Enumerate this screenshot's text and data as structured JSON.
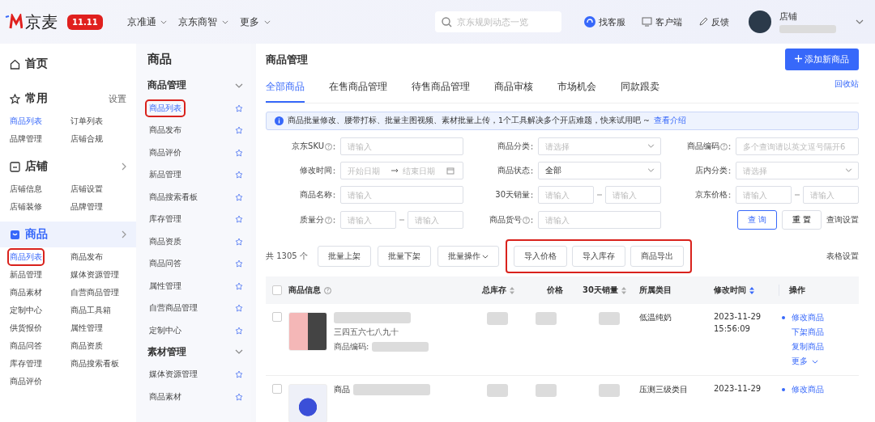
{
  "topbar": {
    "logo": "京麦",
    "badge": "11.11",
    "nav": [
      {
        "label": "京准通"
      },
      {
        "label": "京东商智"
      },
      {
        "label": "更多"
      }
    ],
    "search": {
      "placeholder": "京东规则动态一览"
    },
    "actions": [
      {
        "kind": "service",
        "label": "找客服"
      },
      {
        "kind": "client",
        "label": "客户端"
      },
      {
        "kind": "feedback",
        "label": "反馈"
      }
    ],
    "store": "店铺"
  },
  "sidebar": {
    "home": "首页",
    "sections": [
      {
        "kind": "favorites",
        "title": "常用",
        "link": "设置",
        "selected": false,
        "items": [
          {
            "label": "商品列表",
            "selected": true,
            "highlighted": false
          },
          {
            "label": "订单列表",
            "selected": false,
            "highlighted": false
          },
          {
            "label": "品牌管理",
            "selected": false,
            "highlighted": false
          },
          {
            "label": "店铺合规",
            "selected": false,
            "highlighted": false
          }
        ]
      },
      {
        "kind": "store",
        "title": "店铺",
        "selected": false,
        "items": [
          {
            "label": "店铺信息",
            "selected": false,
            "highlighted": false
          },
          {
            "label": "店铺设置",
            "selected": false,
            "highlighted": false
          },
          {
            "label": "店铺装修",
            "selected": false,
            "highlighted": false
          },
          {
            "label": "品牌管理",
            "selected": false,
            "highlighted": false
          }
        ]
      },
      {
        "kind": "goods",
        "title": "商品",
        "selected": true,
        "items": [
          {
            "label": "商品列表",
            "selected": true,
            "highlighted": true
          },
          {
            "label": "商品发布",
            "selected": false,
            "highlighted": false
          },
          {
            "label": "新品管理",
            "selected": false,
            "highlighted": false
          },
          {
            "label": "媒体资源管理",
            "selected": false,
            "highlighted": false
          },
          {
            "label": "商品素材",
            "selected": false,
            "highlighted": false
          },
          {
            "label": "自营商品管理",
            "selected": false,
            "highlighted": false
          },
          {
            "label": "定制中心",
            "selected": false,
            "highlighted": false
          },
          {
            "label": "商品工具箱",
            "selected": false,
            "highlighted": false
          },
          {
            "label": "供货报价",
            "selected": false,
            "highlighted": false
          },
          {
            "label": "属性管理",
            "selected": false,
            "highlighted": false
          },
          {
            "label": "商品问答",
            "selected": false,
            "highlighted": false
          },
          {
            "label": "商品资质",
            "selected": false,
            "highlighted": false
          },
          {
            "label": "库存管理",
            "selected": false,
            "highlighted": false
          },
          {
            "label": "商品搜索看板",
            "selected": false,
            "highlighted": false
          },
          {
            "label": "商品评价",
            "selected": false,
            "highlighted": false
          }
        ]
      }
    ]
  },
  "submenu": {
    "title": "商品",
    "groups": [
      {
        "title": "商品管理",
        "expanded": true,
        "items": [
          {
            "label": "商品列表",
            "selected": true,
            "highlighted": true
          },
          {
            "label": "商品发布",
            "selected": false,
            "highlighted": false
          },
          {
            "label": "商品评价",
            "selected": false,
            "highlighted": false
          },
          {
            "label": "新品管理",
            "selected": false,
            "highlighted": false
          },
          {
            "label": "商品搜索看板",
            "selected": false,
            "highlighted": false
          },
          {
            "label": "库存管理",
            "selected": false,
            "highlighted": false
          },
          {
            "label": "商品资质",
            "selected": false,
            "highlighted": false
          },
          {
            "label": "商品问答",
            "selected": false,
            "highlighted": false
          },
          {
            "label": "属性管理",
            "selected": false,
            "highlighted": false
          },
          {
            "label": "自营商品管理",
            "selected": false,
            "highlighted": false
          },
          {
            "label": "定制中心",
            "selected": false,
            "highlighted": false
          }
        ]
      },
      {
        "title": "素材管理",
        "expanded": true,
        "items": [
          {
            "label": "媒体资源管理",
            "selected": false,
            "highlighted": false
          },
          {
            "label": "商品素材",
            "selected": false,
            "highlighted": false
          }
        ]
      }
    ]
  },
  "page": {
    "title": "商品管理",
    "add_button": "添加新商品",
    "tabs": [
      {
        "label": "全部商品",
        "selected": true
      },
      {
        "label": "在售商品管理",
        "selected": false
      },
      {
        "label": "待售商品管理",
        "selected": false
      },
      {
        "label": "商品审核",
        "selected": false
      },
      {
        "label": "市场机会",
        "selected": false
      },
      {
        "label": "同款跟卖",
        "selected": false
      }
    ],
    "recycle": "回收站",
    "notice": {
      "text": "商品批量修改、腰带打标、批量主图视频、素材批量上传，1个工具解决多个开店难题，快来试用吧 ~",
      "link": "查看介绍"
    },
    "filters": [
      {
        "label": "京东SKU",
        "help": true,
        "kind": "input",
        "placeholder": "请输入"
      },
      {
        "label": "商品分类",
        "help": false,
        "kind": "select",
        "placeholder": "请选择"
      },
      {
        "label": "商品编码",
        "help": true,
        "kind": "input",
        "placeholder": "多个查询请以英文逗号隔开6"
      },
      {
        "label": "修改时间",
        "help": false,
        "kind": "daterange",
        "placeholder": "开始日期",
        "placeholder_end": "结束日期"
      },
      {
        "label": "商品状态",
        "help": false,
        "kind": "select",
        "value": "全部"
      },
      {
        "label": "店内分类",
        "help": false,
        "kind": "select",
        "placeholder": "请选择"
      },
      {
        "label": "商品名称",
        "help": false,
        "kind": "input",
        "placeholder": "请输入"
      },
      {
        "label": "30天销量",
        "help": false,
        "kind": "range",
        "placeholder": "请输入",
        "placeholder_end": "请输入"
      },
      {
        "label": "京东价格",
        "help": false,
        "kind": "range",
        "placeholder": "请输入",
        "placeholder_end": "请输入"
      },
      {
        "label": "质量分",
        "help": true,
        "kind": "range",
        "placeholder": "请输入",
        "placeholder_end": "请输入"
      },
      {
        "label": "商品货号",
        "help": true,
        "kind": "input",
        "placeholder": "请输入"
      }
    ],
    "query_button": "查 询",
    "reset_button": "重 置",
    "query_settings": "查询设置",
    "toolbar": {
      "count": "共 1305 个",
      "buttons": [
        {
          "label": "批量上架",
          "dropdown": false
        },
        {
          "label": "批量下架",
          "dropdown": false
        },
        {
          "label": "批量操作",
          "dropdown": true
        }
      ],
      "import_group": {
        "highlighted": true,
        "buttons": [
          "导入价格",
          "导入库存",
          "商品导出"
        ]
      },
      "table_settings": "表格设置"
    },
    "table": {
      "all_checked": false,
      "columns": [
        {
          "label": "商品信息",
          "help": true,
          "sortable": false
        },
        {
          "label": "总库存",
          "help": false,
          "sortable": true,
          "sorted": false
        },
        {
          "label": "价格",
          "help": false,
          "sortable": false
        },
        {
          "label": "30天销量",
          "help": false,
          "sortable": true,
          "sorted": false
        },
        {
          "label": "所属类目",
          "help": false,
          "sortable": false
        },
        {
          "label": "修改时间",
          "help": false,
          "sortable": true,
          "sorted": true
        },
        {
          "label": "操作",
          "help": false,
          "sortable": false
        }
      ],
      "rows": [
        {
          "checked": false,
          "subtitle": "三四五六七八九十",
          "code_label": "商品编码:",
          "category": "低温纯奶",
          "date": "2023-11-29",
          "time": "15:56:09",
          "actions": [
            "修改商品",
            "下架商品",
            "复制商品"
          ],
          "more": "更多"
        },
        {
          "checked": false,
          "name": "商品",
          "category": "压测三级类目",
          "date": "2023-11-29",
          "actions": [
            "修改商品"
          ]
        }
      ]
    }
  }
}
